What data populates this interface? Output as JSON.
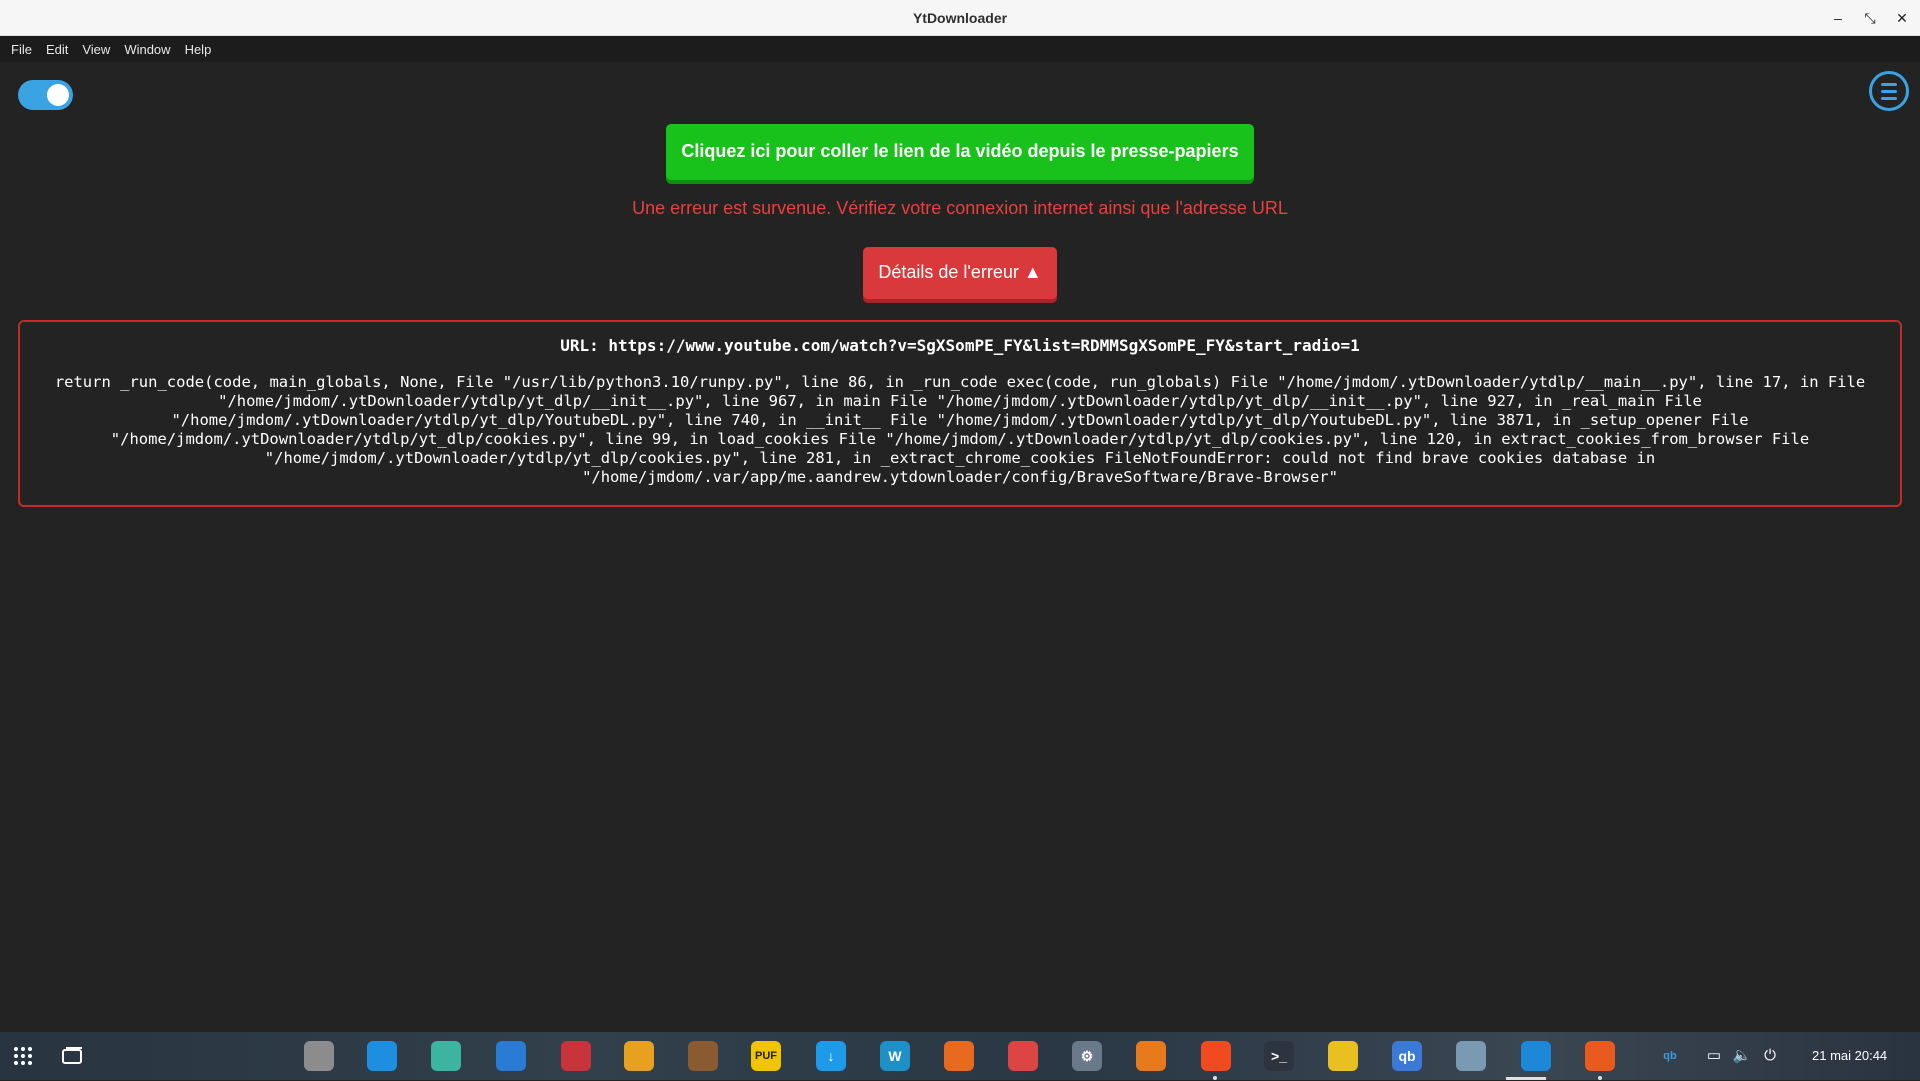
{
  "window": {
    "title": "YtDownloader",
    "minimize_glyph": "–",
    "restore_glyph": "⤡",
    "close_glyph": "✕"
  },
  "menu": [
    "File",
    "Edit",
    "View",
    "Window",
    "Help"
  ],
  "main": {
    "theme_toggle_on": true,
    "paste_button_label": "Cliquez ici pour coller le lien de la vidéo depuis le presse-papiers",
    "error_message": "Une erreur est survenue. Vérifiez votre connexion internet ainsi que l'adresse URL",
    "details_button_label": "Détails de l'erreur ▲",
    "error_url": "URL: https://www.youtube.com/watch?v=SgXSomPE_FY&list=RDMMSgXSomPE_FY&start_radio=1",
    "error_trace": "return _run_code(code, main_globals, None, File \"/usr/lib/python3.10/runpy.py\", line 86, in _run_code exec(code, run_globals) File \"/home/jmdom/.ytDownloader/ytdlp/__main__.py\", line 17, in File \"/home/jmdom/.ytDownloader/ytdlp/yt_dlp/__init__.py\", line 967, in main File \"/home/jmdom/.ytDownloader/ytdlp/yt_dlp/__init__.py\", line 927, in _real_main File \"/home/jmdom/.ytDownloader/ytdlp/yt_dlp/YoutubeDL.py\", line 740, in __init__ File \"/home/jmdom/.ytDownloader/ytdlp/yt_dlp/YoutubeDL.py\", line 3871, in _setup_opener File \"/home/jmdom/.ytDownloader/ytdlp/yt_dlp/cookies.py\", line 99, in load_cookies File \"/home/jmdom/.ytDownloader/ytdlp/yt_dlp/cookies.py\", line 120, in extract_cookies_from_browser File \"/home/jmdom/.ytDownloader/ytdlp/yt_dlp/cookies.py\", line 281, in _extract_chrome_cookies FileNotFoundError: could not find brave cookies database in \"/home/jmdom/.var/app/me.aandrew.ytdownloader/config/BraveSoftware/Brave-Browser\""
  },
  "colors": {
    "accent": "#3aa3e3",
    "success": "#18c21a",
    "error": "#e8403f",
    "background": "#232323"
  },
  "taskbar": {
    "apps": [
      {
        "name": "files-icon",
        "glyph": "",
        "color": "#8c8c8c"
      },
      {
        "name": "store-icon",
        "glyph": "",
        "color": "#1e8fe0"
      },
      {
        "name": "scanner-icon",
        "glyph": "",
        "color": "#3cb4a0"
      },
      {
        "name": "mail-icon",
        "glyph": "",
        "color": "#2a7bd4"
      },
      {
        "name": "games-icon",
        "glyph": "",
        "color": "#c8343a"
      },
      {
        "name": "layers-icon",
        "glyph": "",
        "color": "#e8a020"
      },
      {
        "name": "library-icon",
        "glyph": "",
        "color": "#8a5a30"
      },
      {
        "name": "puf-icon",
        "glyph": "PUF",
        "color": "#f2c400"
      },
      {
        "name": "download-icon",
        "glyph": "↓",
        "color": "#1e9be8"
      },
      {
        "name": "waveform-icon",
        "glyph": "W",
        "color": "#1e90c8"
      },
      {
        "name": "pdf-icon",
        "glyph": "",
        "color": "#e86a1e"
      },
      {
        "name": "disk-icon",
        "glyph": "",
        "color": "#d44"
      },
      {
        "name": "settings-icon",
        "glyph": "⚙",
        "color": "#6a7a8a"
      },
      {
        "name": "chart-icon",
        "glyph": "",
        "color": "#e87a1e"
      },
      {
        "name": "brave-icon",
        "glyph": "",
        "color": "#f04a1e"
      },
      {
        "name": "terminal-icon",
        "glyph": ">_",
        "color": "#2c3440"
      },
      {
        "name": "paint-icon",
        "glyph": "",
        "color": "#e8c020"
      },
      {
        "name": "qbittorrent-icon",
        "glyph": "qb",
        "color": "#3a7ad4"
      },
      {
        "name": "globe-icon",
        "glyph": "",
        "color": "#7a9ab4"
      },
      {
        "name": "ytdownloader-icon",
        "glyph": "",
        "color": "#1e88d8"
      },
      {
        "name": "firefox-icon",
        "glyph": "",
        "color": "#e85a1e"
      }
    ],
    "tray": {
      "qbittorrent_glyph": "qb",
      "display_glyph": "▭",
      "volume_glyph": "🔈",
      "power_glyph": "⏻"
    },
    "clock": "21 mai  20:44"
  }
}
